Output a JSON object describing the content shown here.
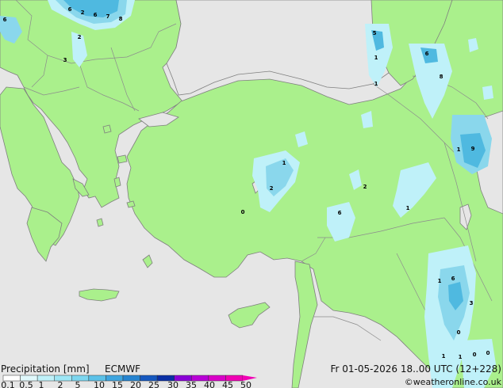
{
  "map": {
    "colors": {
      "sea": "#e6e6e6",
      "land": "#aaf08c",
      "border": "#7f7f7f",
      "precip_light": "#bff1f9",
      "precip_medium": "#8ad7ec",
      "precip_heavy": "#4fb9e0",
      "precip_strong": "#2b8ed4"
    },
    "precip_labels": [
      "6",
      "2",
      "6",
      "7",
      "8",
      "6",
      "2",
      "3",
      "5",
      "1",
      "6",
      "8",
      "1",
      "1",
      "9",
      "1",
      "2",
      "2",
      "0",
      "6",
      "1",
      "1",
      "6",
      "3",
      "0",
      "1",
      "1",
      "0",
      "0"
    ]
  },
  "legend": {
    "title": "Precipitation [mm]",
    "model": "ECMWF",
    "ticks": [
      "0.1",
      "0.5",
      "1",
      "2",
      "5",
      "10",
      "15",
      "20",
      "25",
      "30",
      "35",
      "40",
      "45",
      "50"
    ],
    "colors": [
      "#ffffff",
      "#e0f8fb",
      "#bff1f9",
      "#9ee6f5",
      "#7dd6ef",
      "#5cc1e8",
      "#3ea5df",
      "#2684d0",
      "#1558bf",
      "#0a2fa5",
      "#8a00d6",
      "#b800d6",
      "#d900c8",
      "#f000b4"
    ]
  },
  "datetime": "Fr 01-05-2026 18..00 UTC (12+228)",
  "credit": "©weatheronline.co.uk"
}
